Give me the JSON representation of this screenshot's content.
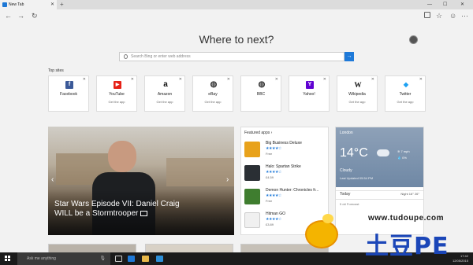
{
  "browser": {
    "tab_title": "New Tab",
    "new_tab_symbol": "+",
    "tab_close": "✕",
    "window_controls": [
      "—",
      "☐",
      "✕"
    ]
  },
  "hero": {
    "title": "Where to next?",
    "search_placeholder": "Search Bing or enter web address"
  },
  "top_sites": {
    "label": "Top sites",
    "items": [
      {
        "name": "Facebook",
        "icon": "facebook-icon",
        "color": "#3b5998",
        "glyph": "f",
        "sub": ""
      },
      {
        "name": "YouTube",
        "icon": "youtube-icon",
        "color": "#e62117",
        "glyph": "▶",
        "sub": "Get the app"
      },
      {
        "name": "Amazon",
        "icon": "amazon-icon",
        "color": "#ffffff",
        "glyph": "a",
        "sub": "Get the app"
      },
      {
        "name": "eBay",
        "icon": "globe-icon",
        "color": "#ffffff",
        "glyph": "◍",
        "sub": "Get the app"
      },
      {
        "name": "BBC",
        "icon": "globe-icon",
        "color": "#ffffff",
        "glyph": "◍",
        "sub": ""
      },
      {
        "name": "Yahoo!",
        "icon": "yahoo-icon",
        "color": "#6001d2",
        "glyph": "Y",
        "sub": ""
      },
      {
        "name": "Wikipedia",
        "icon": "wikipedia-icon",
        "color": "#ffffff",
        "glyph": "W",
        "sub": "Get the app"
      },
      {
        "name": "Twitter",
        "icon": "twitter-icon",
        "color": "#ffffff",
        "glyph": "🐦",
        "sub": "Get the app"
      }
    ]
  },
  "news": {
    "headline_line1": "Star Wars Episode VII: Daniel Craig",
    "headline_line2": "WILL be a Stormtrooper"
  },
  "featured_apps": {
    "label": "Featured apps",
    "items": [
      {
        "name": "Big Business Deluxe",
        "stars": "★★★★☆",
        "price": "Free",
        "color": "#e8a21b"
      },
      {
        "name": "Halo: Spartan Strike",
        "stars": "★★★★☆",
        "price": "£4.59",
        "color": "#2a2f34"
      },
      {
        "name": "Demon Hunter: Chronicles fr...",
        "stars": "★★★★☆",
        "price": "Free",
        "color": "#3f7d2f"
      },
      {
        "name": "Hitman GO",
        "stars": "★★★★☆",
        "price": "£3.89",
        "color": "#f0f0f0"
      }
    ]
  },
  "weather": {
    "city": "London",
    "temp": "14°C",
    "condition": "Cloudy",
    "updated": "Last Updated 05:54 PM",
    "wind": "7 mph",
    "humidity": "0%",
    "today_label": "Today",
    "today_value": "Night 16° 26°",
    "next_label": "5 dd Forecast"
  },
  "taskbar": {
    "search_text": "Ask me anything",
    "clock": "17:42\n12/05/2015"
  },
  "watermark": {
    "url": "www.tudoupe.com",
    "brand": "土豆PE"
  }
}
